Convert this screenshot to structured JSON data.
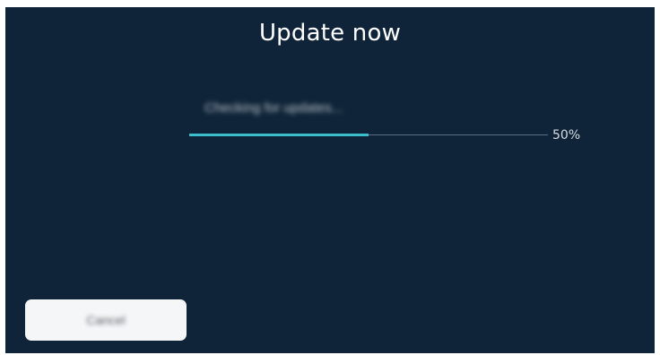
{
  "dialog": {
    "title": "Update now",
    "status_text": "Checking for updates...",
    "progress": {
      "percent_label": "50%",
      "fraction": 0.5
    },
    "bottom_button_label": "Cancel"
  },
  "colors": {
    "background": "#0f2438",
    "progress_fill": "#3bbfcc",
    "progress_track": "#5a6f80",
    "button_bg": "#f5f6f7"
  }
}
